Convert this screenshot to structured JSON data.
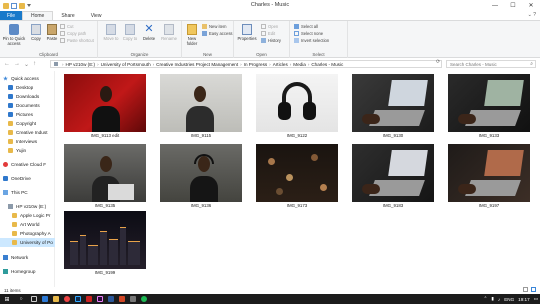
{
  "window": {
    "title": "Charles - Music",
    "controls": {
      "minimize": "—",
      "maximize": "☐",
      "close": "✕"
    }
  },
  "ribbon_tabs": [
    "File",
    "Home",
    "Share",
    "View"
  ],
  "ribbon": {
    "clipboard": {
      "label": "Clipboard",
      "pin": "Pin to Quick access",
      "copy": "Copy",
      "paste": "Paste",
      "cut": "Cut",
      "copy_path": "Copy path",
      "paste_shortcut": "Paste shortcut"
    },
    "organize": {
      "label": "Organize",
      "move_to": "Move to",
      "copy_to": "Copy to",
      "delete": "Delete",
      "rename": "Rename"
    },
    "new": {
      "label": "New",
      "new_folder": "New folder",
      "new_item": "New item",
      "easy_access": "Easy access"
    },
    "open": {
      "label": "Open",
      "properties": "Properties",
      "open": "Open",
      "edit": "Edit",
      "history": "History"
    },
    "select": {
      "label": "Select",
      "select_all": "Select all",
      "select_none": "Select none",
      "invert_selection": "Invert selection"
    }
  },
  "address": {
    "crumbs": [
      "HP v210w (E:)",
      "University of Portsmouth",
      "Creative Industries Project Management",
      "In Progress",
      "Articles",
      "Media",
      "Charles - Music"
    ],
    "search_placeholder": "Search Charles - Music"
  },
  "sidebar": {
    "items": [
      {
        "label": "Quick access",
        "icon": "star-icon"
      },
      {
        "label": "Desktop",
        "icon": "desktop-icon"
      },
      {
        "label": "Downloads",
        "icon": "downloads-icon"
      },
      {
        "label": "Documents",
        "icon": "documents-icon"
      },
      {
        "label": "Pictures",
        "icon": "pictures-icon"
      },
      {
        "label": "Copyright",
        "icon": "folder-icon"
      },
      {
        "label": "Creative Indust",
        "icon": "folder-icon"
      },
      {
        "label": "Interviews",
        "icon": "folder-icon"
      },
      {
        "label": "Yujin",
        "icon": "folder-icon"
      },
      {
        "label": "Creative Cloud F",
        "icon": "creative-cloud-icon"
      },
      {
        "label": "OneDrive",
        "icon": "onedrive-icon"
      },
      {
        "label": "This PC",
        "icon": "pc-icon"
      },
      {
        "label": "HP v210w (E:)",
        "icon": "drive-icon"
      },
      {
        "label": "Apple Logic Pr",
        "icon": "folder-icon"
      },
      {
        "label": "Art World",
        "icon": "folder-icon"
      },
      {
        "label": "Photography A",
        "icon": "folder-icon"
      },
      {
        "label": "University of Po",
        "icon": "folder-icon"
      },
      {
        "label": "Network",
        "icon": "network-icon"
      },
      {
        "label": "Homegroup",
        "icon": "homegroup-icon"
      }
    ]
  },
  "files": [
    {
      "name": "IMG_9113 edit"
    },
    {
      "name": "IMG_9115"
    },
    {
      "name": "IMG_9122"
    },
    {
      "name": "IMG_9130"
    },
    {
      "name": "IMG_9133"
    },
    {
      "name": "IMG_9135"
    },
    {
      "name": "IMG_9136"
    },
    {
      "name": "IMG_9173"
    },
    {
      "name": "IMG_9183"
    },
    {
      "name": "IMG_9197"
    },
    {
      "name": "IMG_9199"
    }
  ],
  "status": {
    "count": "11 items"
  },
  "taskbar": {
    "lang": "ENG",
    "time": "19:17"
  }
}
